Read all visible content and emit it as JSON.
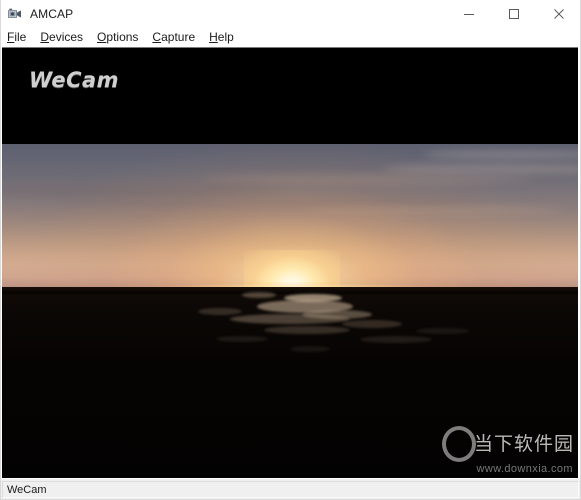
{
  "window": {
    "title": "AMCAP",
    "icon": "camera-icon",
    "controls": {
      "minimize": "minimize-icon",
      "maximize": "maximize-icon",
      "close": "close-icon"
    }
  },
  "menu": {
    "items": [
      {
        "label": "File",
        "accel": "F",
        "rest": "ile"
      },
      {
        "label": "Devices",
        "accel": "D",
        "rest": "evices"
      },
      {
        "label": "Options",
        "accel": "O",
        "rest": "ptions"
      },
      {
        "label": "Capture",
        "accel": "C",
        "rest": "apture"
      },
      {
        "label": "Help",
        "accel": "H",
        "rest": "elp"
      }
    ]
  },
  "preview": {
    "logo_text": "WeCam",
    "background_color": "#000000",
    "scene": "sunset over water with dark silhouetted shoreline"
  },
  "watermark": {
    "brand": "当下软件园",
    "url": "www.downxia.com",
    "ring_icon": "ring-logo-icon"
  },
  "status": {
    "text": "WeCam"
  },
  "colors": {
    "title_bar": "#ffffff",
    "menu_text": "#1b1b1b",
    "video_background": "#000000",
    "status_bar": "#f0f0f0",
    "logo_text": "#cfcfcf",
    "sky_top": "#5d6070",
    "sky_horizon": "#d3ab90",
    "sun": "#fffdf4",
    "land": "#060403"
  }
}
